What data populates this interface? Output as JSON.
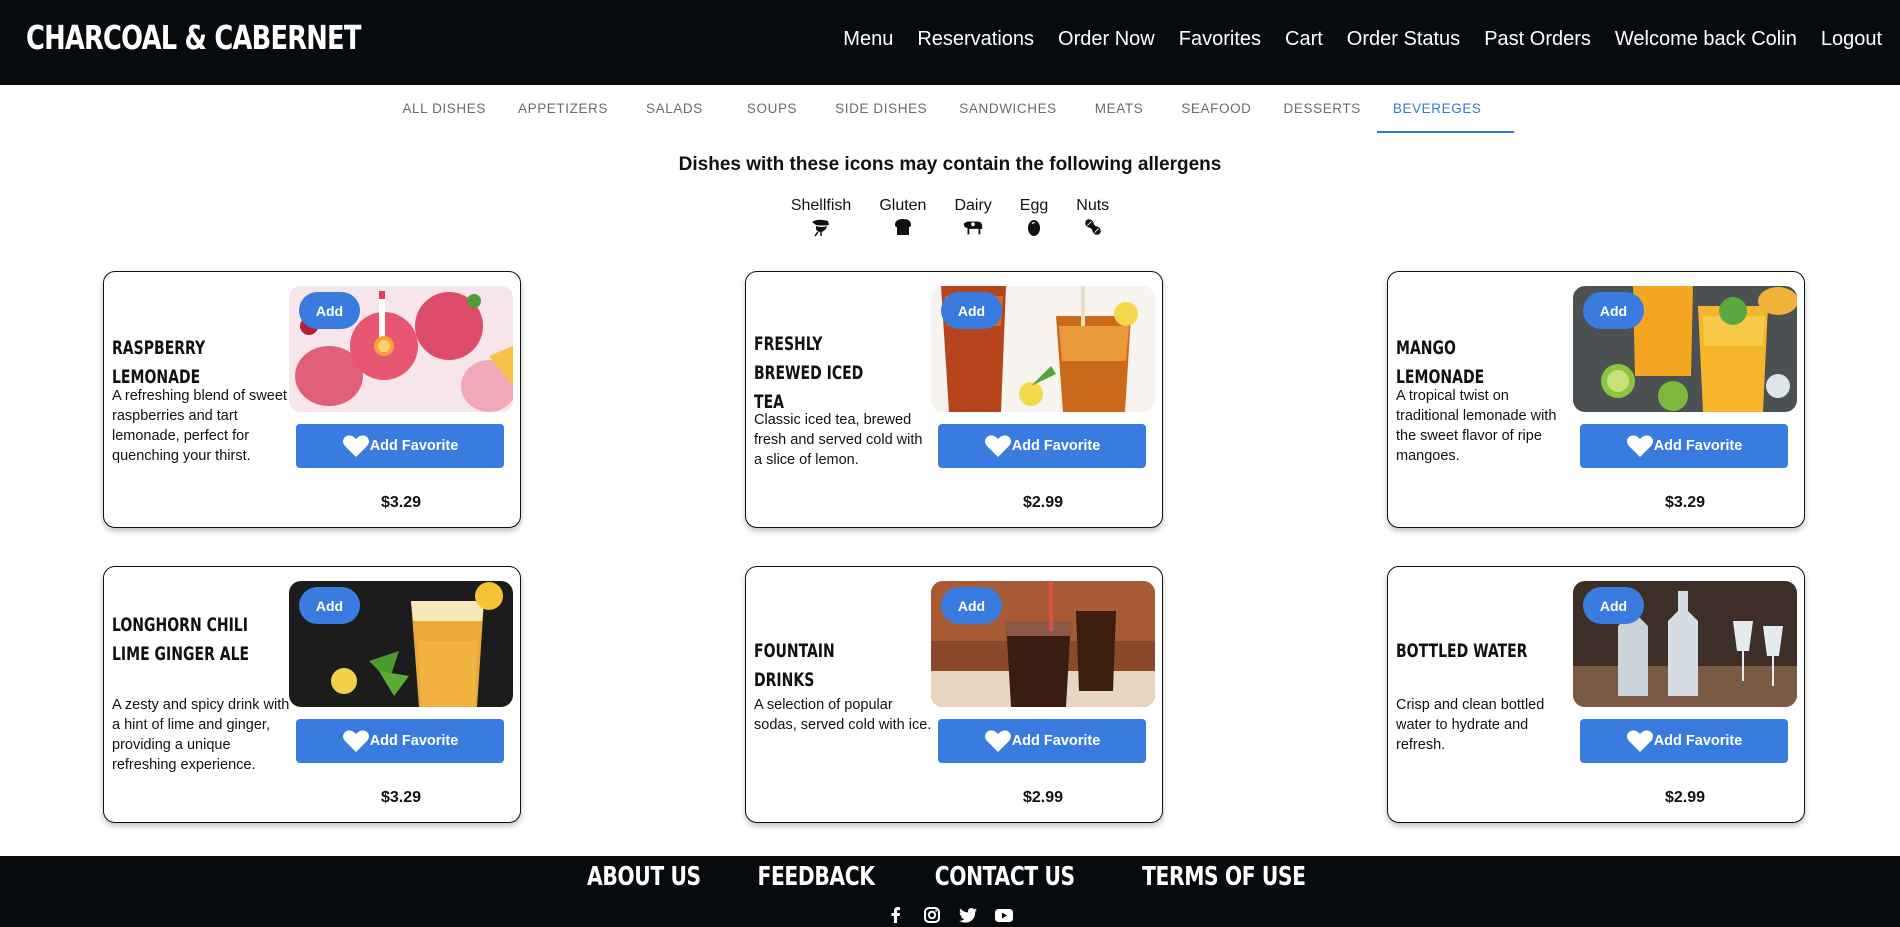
{
  "header": {
    "brand": "CHARCOAL & CABERNET",
    "nav": [
      "Menu",
      "Reservations",
      "Order Now",
      "Favorites",
      "Cart",
      "Order Status",
      "Past Orders",
      "Welcome back Colin",
      "Logout"
    ]
  },
  "categories": {
    "items": [
      "ALL DISHES",
      "APPETIZERS",
      "SALADS",
      "SOUPS",
      "SIDE DISHES",
      "SANDWICHES",
      "MEATS",
      "SEAFOOD",
      "DESSERTS",
      "BEVEREGES"
    ],
    "active": "BEVEREGES"
  },
  "allergens": {
    "heading": "Dishes with these icons may contain the following allergens",
    "items": [
      {
        "label": "Shellfish",
        "icon": "shrimp-icon"
      },
      {
        "label": "Gluten",
        "icon": "bread-icon"
      },
      {
        "label": "Dairy",
        "icon": "cow-icon"
      },
      {
        "label": "Egg",
        "icon": "egg-icon"
      },
      {
        "label": "Nuts",
        "icon": "peanut-icon"
      }
    ]
  },
  "buttons": {
    "add": "Add",
    "favorite": "Add Favorite"
  },
  "dishes": [
    {
      "name": "RASPBERRY LEMONADE",
      "description": "A refreshing blend of sweet raspberries and tart lemonade, perfect for quenching your thirst.",
      "price": "$3.29",
      "photo": "raspberry-lemonade-photo"
    },
    {
      "name": "FRESHLY BREWED ICED TEA",
      "description": "Classic iced tea, brewed fresh and served cold with a slice of lemon.",
      "price": "$2.99",
      "photo": "iced-tea-photo"
    },
    {
      "name": "MANGO LEMONADE",
      "description": "A tropical twist on traditional lemonade with the sweet flavor of ripe mangoes.",
      "price": "$3.29",
      "photo": "mango-lemonade-photo"
    },
    {
      "name": "LONGHORN CHILI LIME GINGER ALE",
      "description": "A zesty and spicy drink with a hint of lime and ginger, providing a unique refreshing experience.",
      "price": "$3.29",
      "photo": "ginger-ale-photo"
    },
    {
      "name": "FOUNTAIN DRINKS",
      "description": "A selection of popular sodas, served cold with ice.",
      "price": "$2.99",
      "photo": "fountain-drinks-photo"
    },
    {
      "name": "BOTTLED WATER",
      "description": "Crisp and clean bottled water to hydrate and refresh.",
      "price": "$2.99",
      "photo": "bottled-water-photo"
    }
  ],
  "footer": {
    "links": [
      "ABOUT US",
      "FEEDBACK",
      "CONTACT US",
      "TERMS OF USE"
    ],
    "social": [
      "facebook-icon",
      "instagram-icon",
      "twitter-icon",
      "youtube-icon"
    ]
  },
  "colors": {
    "header_bg": "#080b0e",
    "accent": "#3a7be0",
    "active_tab": "#3277d8"
  }
}
